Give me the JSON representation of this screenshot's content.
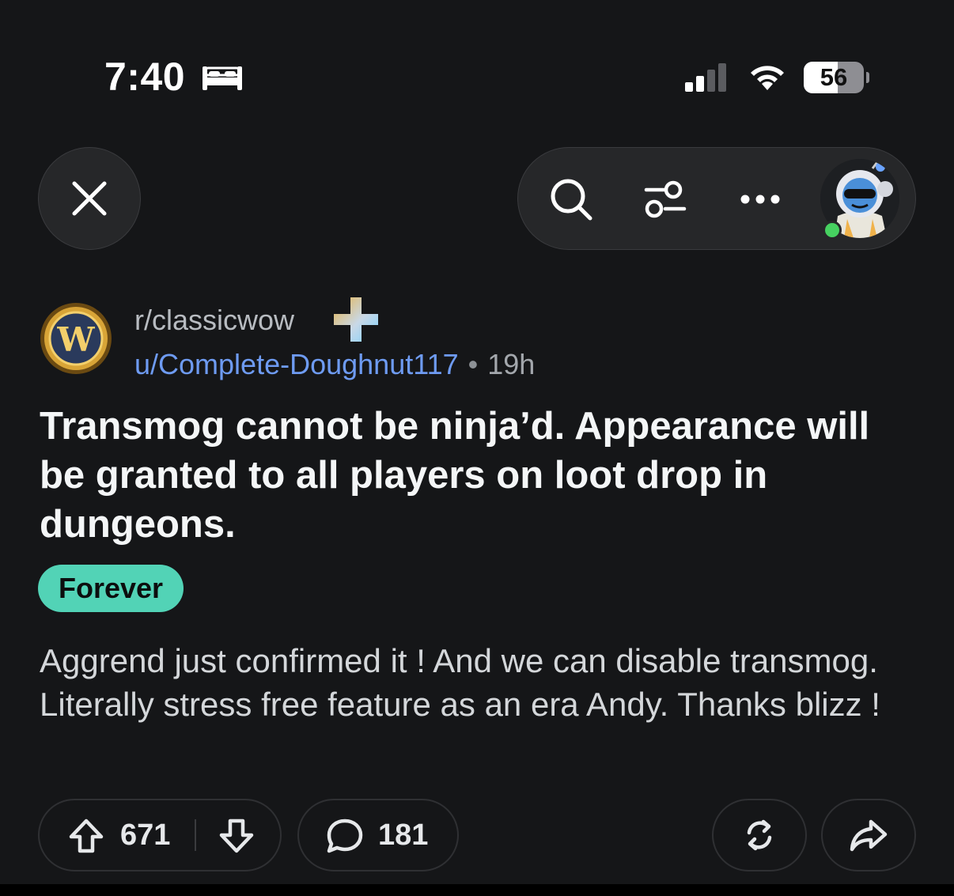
{
  "status_bar": {
    "time": "7:40",
    "battery_level": 56,
    "battery_label": "56",
    "icons": [
      "bed-icon",
      "cellular-signal-icon",
      "wifi-icon",
      "battery-icon"
    ]
  },
  "toolbar": {
    "close_icon": "close-icon",
    "icons": [
      "search-icon",
      "filter-sliders-icon",
      "more-options-icon",
      "user-avatar"
    ],
    "online_status_color": "#46d160"
  },
  "post": {
    "subreddit": "r/classicwow",
    "author": "u/Complete-Doughnut117",
    "separator": "•",
    "time_ago": "19h",
    "title": "Transmog cannot be ninja’d. Appearance will be granted to all players on loot drop in dungeons.",
    "flair": "Forever",
    "body": "Aggrend just confirmed it ! And we can disable transmog. Literally stress free feature as an era Andy. Thanks blizz !"
  },
  "actions": {
    "upvotes": "671",
    "comments": "181",
    "icons": [
      "upvote-icon",
      "downvote-icon",
      "comment-icon",
      "repost-icon",
      "share-icon"
    ]
  },
  "colors": {
    "background": "#151618",
    "author_link": "#6e9bf2",
    "flair_bg": "#52d3b6",
    "pill_bg": "#262729"
  }
}
